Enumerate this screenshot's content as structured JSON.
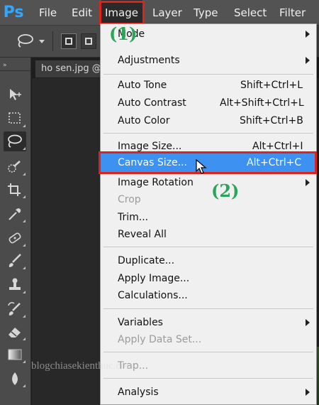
{
  "app": {
    "logo": "Ps"
  },
  "menubar": {
    "items": [
      {
        "label": "File"
      },
      {
        "label": "Edit"
      },
      {
        "label": "Image"
      },
      {
        "label": "Layer"
      },
      {
        "label": "Type"
      },
      {
        "label": "Select"
      },
      {
        "label": "Filter"
      }
    ]
  },
  "document": {
    "tab_title": "ho sen.jpg @"
  },
  "image_menu": {
    "items": [
      {
        "label": "Mode",
        "has_submenu": true
      },
      {
        "label": "Adjustments",
        "has_submenu": true
      },
      {
        "label": "Auto Tone",
        "shortcut": "Shift+Ctrl+L"
      },
      {
        "label": "Auto Contrast",
        "shortcut": "Alt+Shift+Ctrl+L"
      },
      {
        "label": "Auto Color",
        "shortcut": "Shift+Ctrl+B"
      },
      {
        "label": "Image Size...",
        "shortcut": "Alt+Ctrl+I"
      },
      {
        "label": "Canvas Size...",
        "shortcut": "Alt+Ctrl+C",
        "highlighted": true
      },
      {
        "label": "Image Rotation",
        "has_submenu": true
      },
      {
        "label": "Crop",
        "disabled": true
      },
      {
        "label": "Trim..."
      },
      {
        "label": "Reveal All"
      },
      {
        "label": "Duplicate..."
      },
      {
        "label": "Apply Image..."
      },
      {
        "label": "Calculations..."
      },
      {
        "label": "Variables",
        "has_submenu": true
      },
      {
        "label": "Apply Data Set...",
        "disabled": true
      },
      {
        "label": "Trap...",
        "disabled": true
      },
      {
        "label": "Analysis",
        "has_submenu": true
      }
    ]
  },
  "annotations": {
    "step1": "(1)",
    "step2": "(2)",
    "watermark": "blogchiasekienthuc.com"
  },
  "colors": {
    "highlight": "#3d91f0",
    "annotation_box": "#e0221d",
    "step_label": "#2aa55a",
    "ps_logo": "#31a8ff"
  },
  "icons": [
    "lasso-icon",
    "move-icon",
    "marquee-icon",
    "lasso-tool-icon",
    "quick-selection-icon",
    "crop-icon",
    "eyedropper-icon",
    "healing-brush-icon",
    "brush-icon",
    "clone-stamp-icon",
    "history-brush-icon",
    "eraser-icon",
    "gradient-icon",
    "blur-icon",
    "submenu-arrow-icon",
    "cursor-icon"
  ]
}
